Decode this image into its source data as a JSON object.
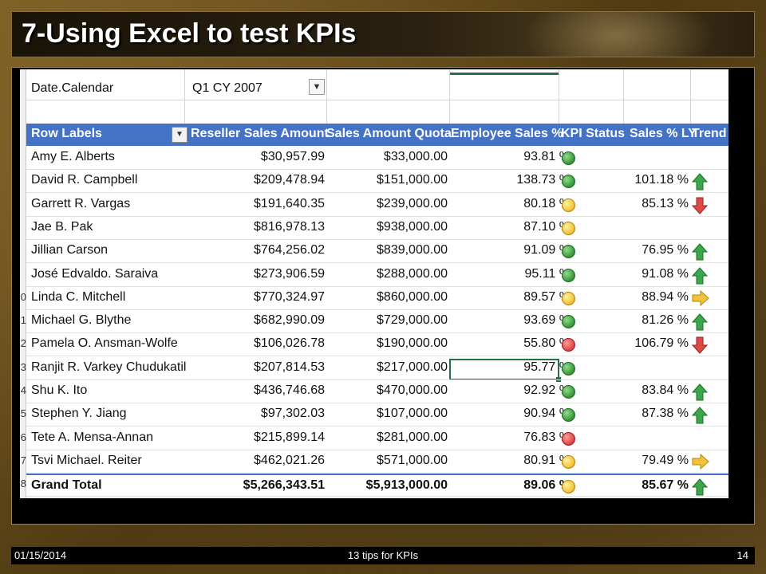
{
  "slide": {
    "title": "7-Using Excel to test KPIs",
    "footer": {
      "date": "01/15/2014",
      "center": "13 tips for KPIs",
      "page": "14"
    }
  },
  "sheet": {
    "filter": {
      "label": "Date.Calendar",
      "value": "Q1 CY 2007"
    },
    "headers": {
      "row_labels": "Row Labels",
      "reseller": "Reseller Sales Amount",
      "quota": "Sales Amount Quota",
      "employee_pct": "Employee Sales %",
      "kpi_status": "KPI Status",
      "sales_ly": "Sales % LY",
      "trend": "Trend"
    },
    "row_numbers": [
      "0",
      "1",
      "2",
      "3",
      "4",
      "5",
      "6",
      "7",
      "8"
    ],
    "rows": [
      {
        "name": "Amy E. Alberts",
        "reseller": "$30,957.99",
        "quota": "$33,000.00",
        "employee_pct": "93.81 %",
        "kpi": "green",
        "sales_ly": "",
        "trend": ""
      },
      {
        "name": "David R. Campbell",
        "reseller": "$209,478.94",
        "quota": "$151,000.00",
        "employee_pct": "138.73 %",
        "kpi": "green",
        "sales_ly": "101.18 %",
        "trend": "up-green"
      },
      {
        "name": "Garrett R. Vargas",
        "reseller": "$191,640.35",
        "quota": "$239,000.00",
        "employee_pct": "80.18 %",
        "kpi": "yellow",
        "sales_ly": "85.13 %",
        "trend": "down-red"
      },
      {
        "name": "Jae B. Pak",
        "reseller": "$816,978.13",
        "quota": "$938,000.00",
        "employee_pct": "87.10 %",
        "kpi": "yellow",
        "sales_ly": "",
        "trend": ""
      },
      {
        "name": "Jillian Carson",
        "reseller": "$764,256.02",
        "quota": "$839,000.00",
        "employee_pct": "91.09 %",
        "kpi": "green",
        "sales_ly": "76.95 %",
        "trend": "up-green"
      },
      {
        "name": "José Edvaldo. Saraiva",
        "reseller": "$273,906.59",
        "quota": "$288,000.00",
        "employee_pct": "95.11 %",
        "kpi": "green",
        "sales_ly": "91.08 %",
        "trend": "up-green"
      },
      {
        "name": "Linda C. Mitchell",
        "reseller": "$770,324.97",
        "quota": "$860,000.00",
        "employee_pct": "89.57 %",
        "kpi": "yellow",
        "sales_ly": "88.94 %",
        "trend": "right-yellow"
      },
      {
        "name": "Michael G. Blythe",
        "reseller": "$682,990.09",
        "quota": "$729,000.00",
        "employee_pct": "93.69 %",
        "kpi": "green",
        "sales_ly": "81.26 %",
        "trend": "up-green"
      },
      {
        "name": "Pamela O. Ansman-Wolfe",
        "reseller": "$106,026.78",
        "quota": "$190,000.00",
        "employee_pct": "55.80 %",
        "kpi": "red",
        "sales_ly": "106.79 %",
        "trend": "down-red"
      },
      {
        "name": "Ranjit R. Varkey Chudukatil",
        "reseller": "$207,814.53",
        "quota": "$217,000.00",
        "employee_pct": "95.77 %",
        "kpi": "green",
        "sales_ly": "",
        "trend": "",
        "selected": true
      },
      {
        "name": "Shu K. Ito",
        "reseller": "$436,746.68",
        "quota": "$470,000.00",
        "employee_pct": "92.92 %",
        "kpi": "green",
        "sales_ly": "83.84 %",
        "trend": "up-green"
      },
      {
        "name": "Stephen Y. Jiang",
        "reseller": "$97,302.03",
        "quota": "$107,000.00",
        "employee_pct": "90.94 %",
        "kpi": "green",
        "sales_ly": "87.38 %",
        "trend": "up-green"
      },
      {
        "name": "Tete A. Mensa-Annan",
        "reseller": "$215,899.14",
        "quota": "$281,000.00",
        "employee_pct": "76.83 %",
        "kpi": "red",
        "sales_ly": "",
        "trend": ""
      },
      {
        "name": "Tsvi Michael. Reiter",
        "reseller": "$462,021.26",
        "quota": "$571,000.00",
        "employee_pct": "80.91 %",
        "kpi": "yellow",
        "sales_ly": "79.49 %",
        "trend": "right-yellow"
      }
    ],
    "grand_total": {
      "name": "Grand Total",
      "reseller": "$5,266,343.51",
      "quota": "$5,913,000.00",
      "employee_pct": "89.06 %",
      "kpi": "yellow",
      "sales_ly": "85.67 %",
      "trend": "up-green"
    },
    "colors": {
      "header_blue": "#4472c4",
      "selection_green": "#217346",
      "kpi_green": "#3a9a3a",
      "kpi_yellow": "#f2c33a",
      "kpi_red": "#e04848"
    }
  }
}
